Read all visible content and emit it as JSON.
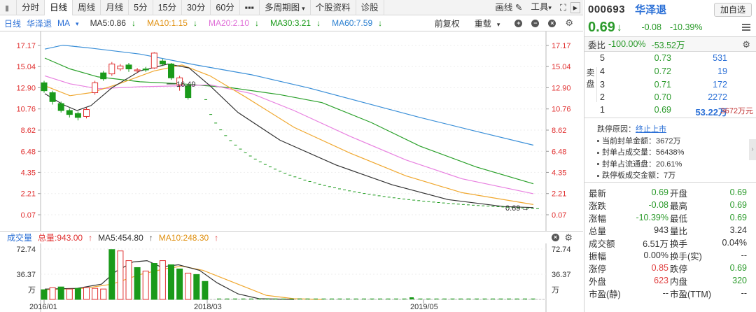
{
  "toolbar": {
    "tabs": [
      "分时",
      "日线",
      "周线",
      "月线",
      "5分",
      "15分",
      "30分",
      "60分",
      "▪▪▪",
      "多周期图",
      "个股资料",
      "诊股"
    ],
    "active_index": 1,
    "right": [
      "画线",
      "工具"
    ]
  },
  "indicators": {
    "period": "日线",
    "name": "华泽退",
    "ma_label": "MA",
    "ma5": "MA5:0.86",
    "ma10": "MA10:1.15",
    "ma20": "MA20:2.10",
    "ma30": "MA30:3.21",
    "ma60": "MA60:7.59",
    "adjust": "前复权",
    "overlay": "重载"
  },
  "colors": {
    "ma5": "#333333",
    "ma10": "#f0a830",
    "ma20": "#e880e0",
    "ma30": "#2aa02a",
    "ma60": "#3a8fd8",
    "up": "#e03030",
    "down": "#1a9a1a"
  },
  "price_axis": [
    "17.17",
    "15.04",
    "12.90",
    "10.76",
    "8.62",
    "6.48",
    "4.35",
    "2.21",
    "0.07"
  ],
  "max_label": "16.49",
  "last_label": "0.69",
  "volume": {
    "label": "成交量",
    "total": "总量:943.00",
    "ma5": "MA5:454.80",
    "ma10": "MA10:248.30",
    "axis": [
      "72.74",
      "36.37",
      "万"
    ]
  },
  "dates": [
    "2016/01",
    "2018/03",
    "2019/05"
  ],
  "chart_data": {
    "type": "candlestick",
    "ylim": [
      0.07,
      17.17
    ],
    "candles": [
      {
        "o": 13.4,
        "c": 12.6,
        "h": 13.6,
        "l": 12.4
      },
      {
        "o": 12.4,
        "c": 11.5,
        "h": 12.6,
        "l": 11.2
      },
      {
        "o": 11.3,
        "c": 10.6,
        "h": 11.5,
        "l": 10.4
      },
      {
        "o": 10.6,
        "c": 10.2,
        "h": 10.8,
        "l": 9.9
      },
      {
        "o": 10.3,
        "c": 9.9,
        "h": 10.5,
        "l": 9.6
      },
      {
        "o": 10.0,
        "c": 10.7,
        "h": 10.9,
        "l": 9.8
      },
      {
        "o": 12.4,
        "c": 13.4,
        "h": 13.6,
        "l": 12.2
      },
      {
        "o": 14.4,
        "c": 13.8,
        "h": 14.6,
        "l": 13.6
      },
      {
        "o": 14.3,
        "c": 15.3,
        "h": 15.5,
        "l": 14.1
      },
      {
        "o": 14.8,
        "c": 15.1,
        "h": 15.3,
        "l": 14.6
      },
      {
        "o": 15.2,
        "c": 14.8,
        "h": 15.4,
        "l": 14.5
      },
      {
        "o": 14.6,
        "c": 14.7,
        "h": 14.9,
        "l": 14.4
      },
      {
        "o": 14.8,
        "c": 14.7,
        "h": 15.0,
        "l": 14.5
      },
      {
        "o": 14.9,
        "c": 16.4,
        "h": 16.49,
        "l": 14.8
      },
      {
        "o": 15.6,
        "c": 15.3,
        "h": 15.8,
        "l": 15.1
      },
      {
        "o": 15.3,
        "c": 13.9,
        "h": 15.4,
        "l": 13.7
      },
      {
        "o": 13.2,
        "c": 13.9,
        "h": 14.1,
        "l": 12.6
      },
      {
        "o": 13.1,
        "c": 11.9,
        "h": 13.2,
        "l": 11.7
      }
    ],
    "limit_down_steps": 68,
    "vol_ymax": 72.74,
    "vol_bars": [
      {
        "v": 14,
        "d": 1
      },
      {
        "v": 17,
        "d": 0
      },
      {
        "v": 18,
        "d": 1
      },
      {
        "v": 15,
        "d": 0
      },
      {
        "v": 16,
        "d": 1
      },
      {
        "v": 17,
        "d": 0
      },
      {
        "v": 16,
        "d": 0
      },
      {
        "v": 15,
        "d": 0
      },
      {
        "v": 72,
        "d": 1
      },
      {
        "v": 70,
        "d": 0
      },
      {
        "v": 56,
        "d": 0
      },
      {
        "v": 46,
        "d": 1
      },
      {
        "v": 41,
        "d": 0
      },
      {
        "v": 52,
        "d": 1
      },
      {
        "v": 56,
        "d": 0
      },
      {
        "v": 50,
        "d": 1
      },
      {
        "v": 44,
        "d": 1
      },
      {
        "v": 38,
        "d": 0
      },
      {
        "v": 36,
        "d": 1
      },
      {
        "v": 26,
        "d": 1
      }
    ]
  },
  "panel": {
    "code": "000693",
    "name": "华泽退",
    "add_btn": "加自选",
    "price": "0.69",
    "chg": "-0.08",
    "pct": "-10.39%",
    "webi_label": "委比",
    "webi_val": "-100.00%",
    "webi_diff": "-53.52万",
    "ask_label": "卖盘",
    "asks": [
      {
        "lvl": "5",
        "pr": "0.73",
        "qty": "531"
      },
      {
        "lvl": "4",
        "pr": "0.72",
        "qty": "19"
      },
      {
        "lvl": "3",
        "pr": "0.71",
        "qty": "172"
      },
      {
        "lvl": "2",
        "pr": "0.70",
        "qty": "2272"
      },
      {
        "lvl": "1",
        "pr": "0.69",
        "qty": "53.22万",
        "amt": "3672万元"
      }
    ],
    "reason_label": "跌停原因：",
    "reason_val": "终止上市",
    "info": [
      "当前封单金额：3672万",
      "封单占成交量：56438%",
      "封单占流通盘：20.61%",
      "跌停板成交金额：7万"
    ],
    "quote_rows": [
      {
        "k": "最新",
        "v": "0.69",
        "vc": "green",
        "k2": "开盘",
        "v2": "0.69",
        "v2c": "green"
      },
      {
        "k": "涨跌",
        "v": "-0.08",
        "vc": "green",
        "k2": "最高",
        "v2": "0.69",
        "v2c": "green"
      },
      {
        "k": "涨幅",
        "v": "-10.39%",
        "vc": "green",
        "k2": "最低",
        "v2": "0.69",
        "v2c": "green"
      },
      {
        "k": "总量",
        "v": "943",
        "vc": "dark",
        "k2": "量比",
        "v2": "3.24",
        "v2c": "dark"
      },
      {
        "k": "成交额",
        "v": "6.51万",
        "vc": "dark",
        "k2": "换手",
        "v2": "0.04%",
        "v2c": "dark"
      },
      {
        "k": "振幅",
        "v": "0.00%",
        "vc": "dark",
        "k2": "换手(实)",
        "v2": "--",
        "v2c": "dark"
      },
      {
        "k": "涨停",
        "v": "0.85",
        "vc": "red",
        "k2": "跌停",
        "v2": "0.69",
        "v2c": "green"
      },
      {
        "k": "外盘",
        "v": "623",
        "vc": "red",
        "k2": "内盘",
        "v2": "320",
        "v2c": "green"
      },
      {
        "k": "市盈(静)",
        "v": "--",
        "vc": "dark",
        "k2": "市盈(TTM)",
        "v2": "--",
        "v2c": "dark"
      }
    ]
  }
}
